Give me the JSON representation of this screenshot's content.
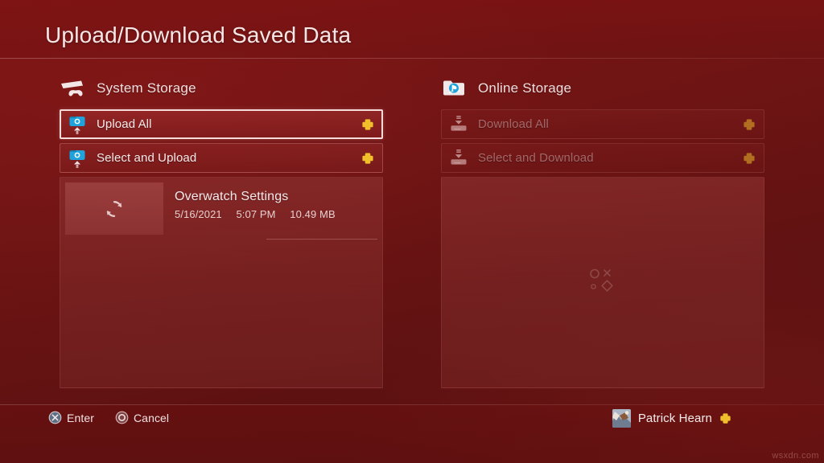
{
  "header": {
    "title": "Upload/Download Saved Data"
  },
  "columns": {
    "system": {
      "icon": "ps4-console-icon",
      "label": "System Storage",
      "actions": [
        {
          "icon": "upload-to-cloud-icon",
          "label": "Upload All",
          "badge": "ps-plus-icon",
          "selected": true,
          "disabled": false
        },
        {
          "icon": "upload-to-cloud-icon",
          "label": "Select and Upload",
          "badge": "ps-plus-icon",
          "selected": false,
          "disabled": false
        }
      ],
      "items": [
        {
          "thumb_icon": "sync-icon",
          "title": "Overwatch Settings",
          "date": "5/16/2021",
          "time": "5:07 PM",
          "size": "10.49 MB"
        }
      ]
    },
    "online": {
      "icon": "online-storage-folder-icon",
      "label": "Online Storage",
      "actions": [
        {
          "icon": "download-from-cloud-icon",
          "label": "Download All",
          "badge": "ps-plus-icon",
          "selected": false,
          "disabled": true
        },
        {
          "icon": "download-from-cloud-icon",
          "label": "Select and Download",
          "badge": "ps-plus-icon",
          "selected": false,
          "disabled": true
        }
      ],
      "items": [],
      "empty_watermark": "playstation-face-buttons-icon"
    }
  },
  "footer": {
    "hints": [
      {
        "glyph": "cross-button-icon",
        "label": "Enter"
      },
      {
        "glyph": "circle-button-icon",
        "label": "Cancel"
      }
    ],
    "user": {
      "avatar": "user-avatar",
      "name": "Patrick Hearn",
      "badge": "ps-plus-icon"
    }
  },
  "watermark": "wsxdn.com",
  "colors": {
    "background_red": "#6e1414",
    "panel_red": "#8d3131",
    "row_red": "#922828",
    "selection_border": "#ffecec",
    "ps_plus_gold": "#f2c12e",
    "cloud_blue": "#16a5dc",
    "text_primary": "#f7eaea",
    "text_muted": "#e8cfcf"
  }
}
